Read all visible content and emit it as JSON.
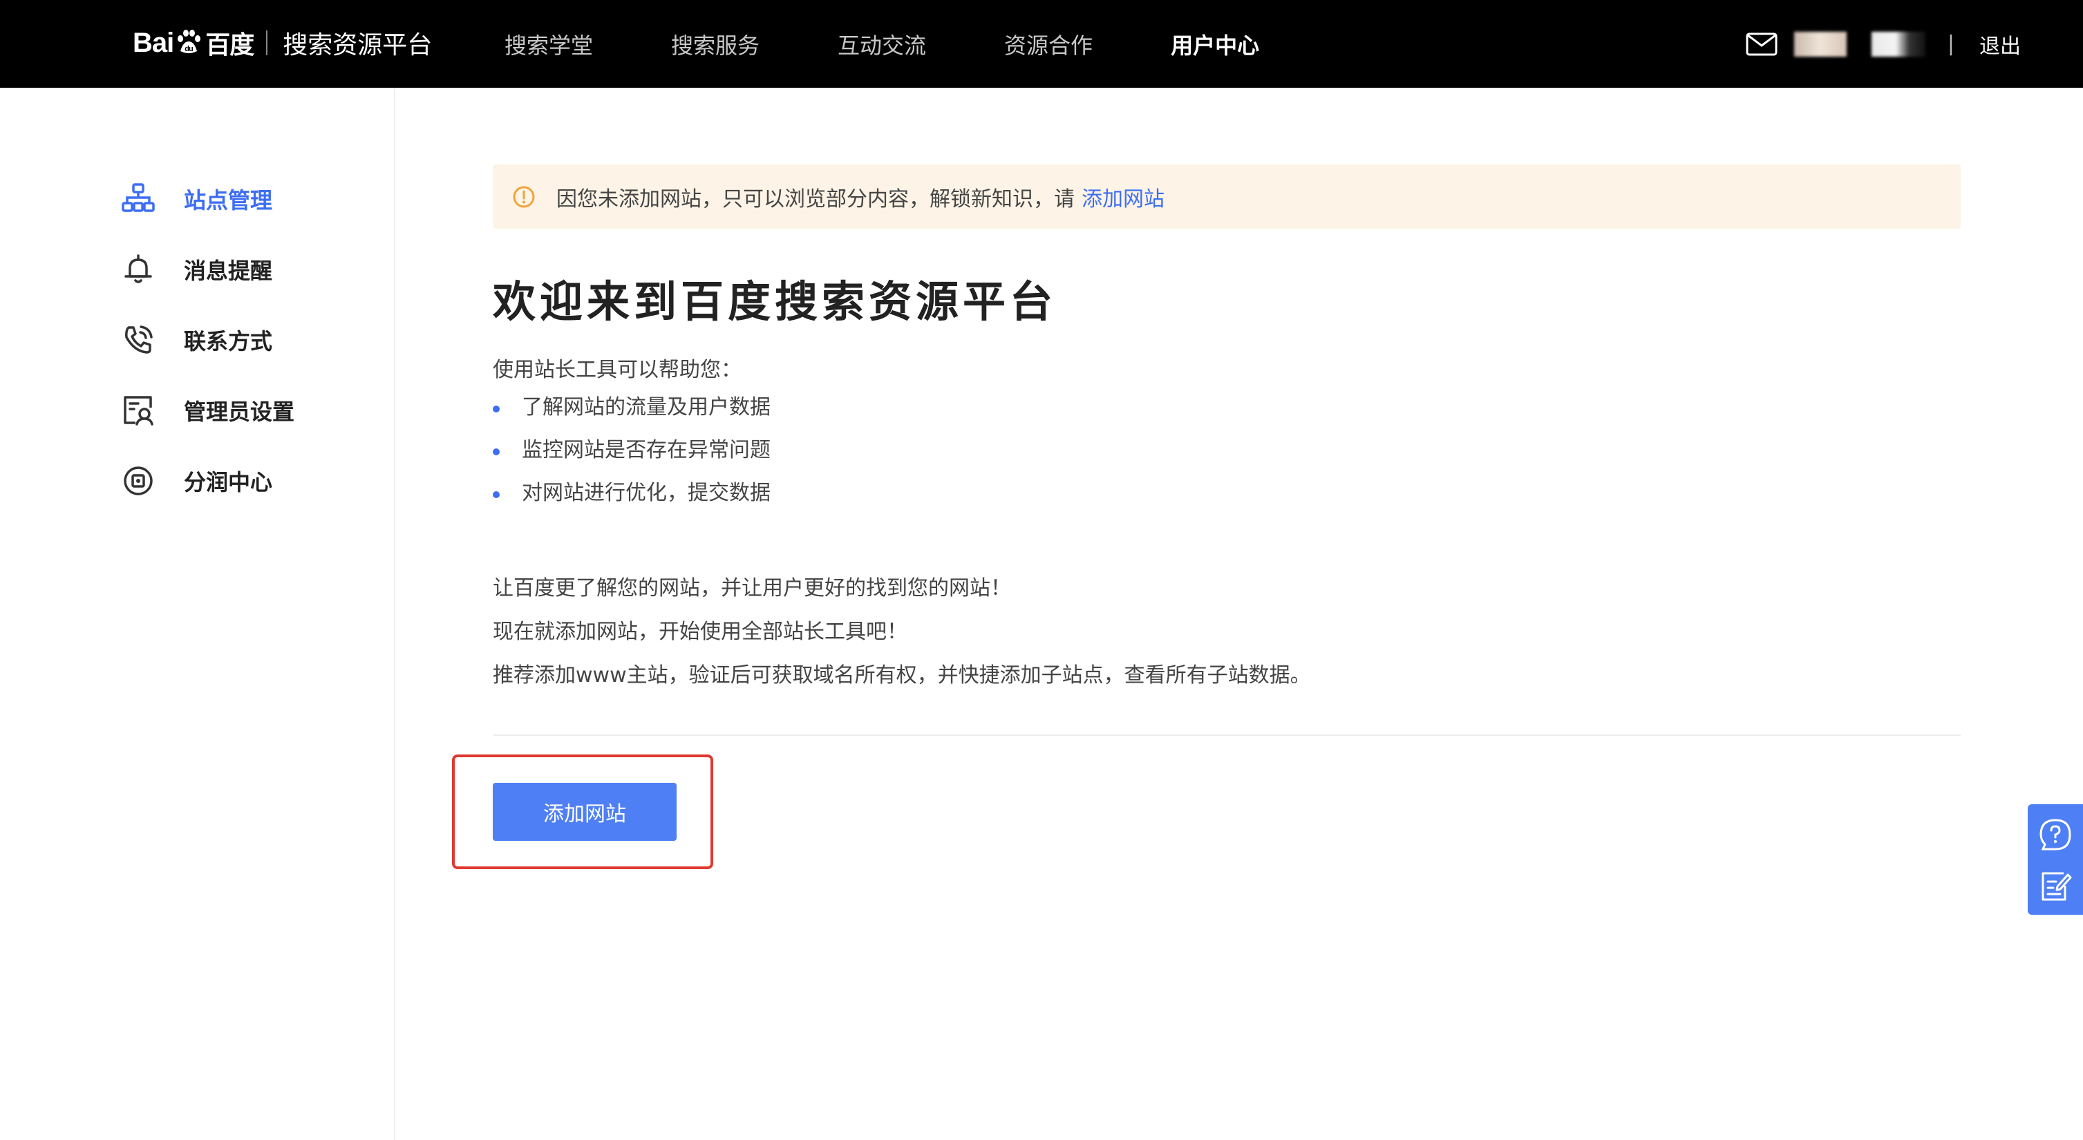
{
  "header": {
    "brand_zh": "百度",
    "brand_title": "搜索资源平台",
    "nav": [
      "搜索学堂",
      "搜索服务",
      "互动交流",
      "资源合作",
      "用户中心"
    ],
    "active_nav": "用户中心",
    "separator": "|",
    "logout": "退出"
  },
  "sidebar": {
    "items": [
      {
        "label": "站点管理",
        "icon": "sitemap-icon",
        "active": true
      },
      {
        "label": "消息提醒",
        "icon": "bell-icon",
        "active": false
      },
      {
        "label": "联系方式",
        "icon": "phone-icon",
        "active": false
      },
      {
        "label": "管理员设置",
        "icon": "admin-icon",
        "active": false
      },
      {
        "label": "分润中心",
        "icon": "revenue-icon",
        "active": false
      }
    ]
  },
  "alert": {
    "text": "因您未添加网站，只可以浏览部分内容，解锁新知识，请",
    "link": "添加网站"
  },
  "main": {
    "title": "欢迎来到百度搜索资源平台",
    "intro": "使用站长工具可以帮助您：",
    "bullets": [
      "了解网站的流量及用户数据",
      "监控网站是否存在异常问题",
      "对网站进行优化，提交数据"
    ],
    "paragraphs": [
      "让百度更了解您的网站，并让用户更好的找到您的网站！",
      "现在就添加网站，开始使用全部站长工具吧！",
      "推荐添加www主站，验证后可获取域名所有权，并快捷添加子站点，查看所有子站数据。"
    ],
    "add_button": "添加网站"
  },
  "colors": {
    "accent": "#3d6ef2",
    "button": "#4e7ff4",
    "alert_bg": "#fdf4e7",
    "alert_icon": "#f0a33a",
    "highlight": "#e0392f"
  },
  "float_panel": [
    "help-icon",
    "feedback-icon"
  ]
}
